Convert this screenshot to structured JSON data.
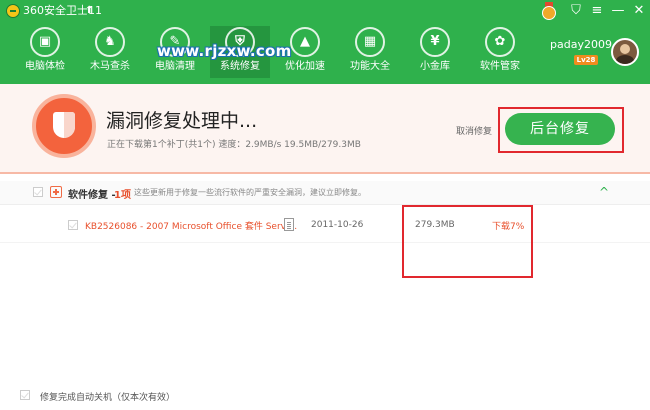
{
  "app": {
    "title": "360安全卫士11",
    "upgrade_icon": "up-arrow-icon"
  },
  "nav": {
    "items": [
      {
        "label": "电脑体检",
        "icon": "monitor-check-icon",
        "glyph": "▣"
      },
      {
        "label": "木马查杀",
        "icon": "horse-icon",
        "glyph": "♞"
      },
      {
        "label": "电脑清理",
        "icon": "broom-icon",
        "glyph": "✎"
      },
      {
        "label": "系统修复",
        "icon": "shield-icon",
        "glyph": "⛨"
      },
      {
        "label": "优化加速",
        "icon": "rocket-icon",
        "glyph": "▲"
      },
      {
        "label": "功能大全",
        "icon": "grid-icon",
        "glyph": "▦"
      },
      {
        "label": "小金库",
        "icon": "money-bag-icon",
        "glyph": "¥"
      },
      {
        "label": "软件管家",
        "icon": "app-store-icon",
        "glyph": "✿"
      }
    ],
    "active_index": 3
  },
  "watermark": "www.rjzxw.com",
  "user": {
    "name": "paday2009",
    "level": "Lv28"
  },
  "status": {
    "title": "漏洞修复处理中...",
    "detail": "正在下载第1个补丁(共1个) 速度：2.9MB/s 19.5MB/279.3MB",
    "cancel_label": "取消修复",
    "background_button_label": "后台修复"
  },
  "section": {
    "title": "软件修复 -",
    "count": "1项",
    "description": "这些更新用于修复一些流行软件的严重安全漏洞，建议立即修复。"
  },
  "items": [
    {
      "name": "KB2526086 - 2007 Microsoft Office 套件 Servi...",
      "date": "2011-10-26",
      "size": "279.3MB",
      "status": "下载7%"
    }
  ],
  "footer": {
    "auto_shutdown_label": "修复完成自动关机（仅本次有效）"
  },
  "colors": {
    "brand_green": "#2fb14c",
    "accent_orange": "#e8502c",
    "highlight_red": "#e1282e"
  }
}
